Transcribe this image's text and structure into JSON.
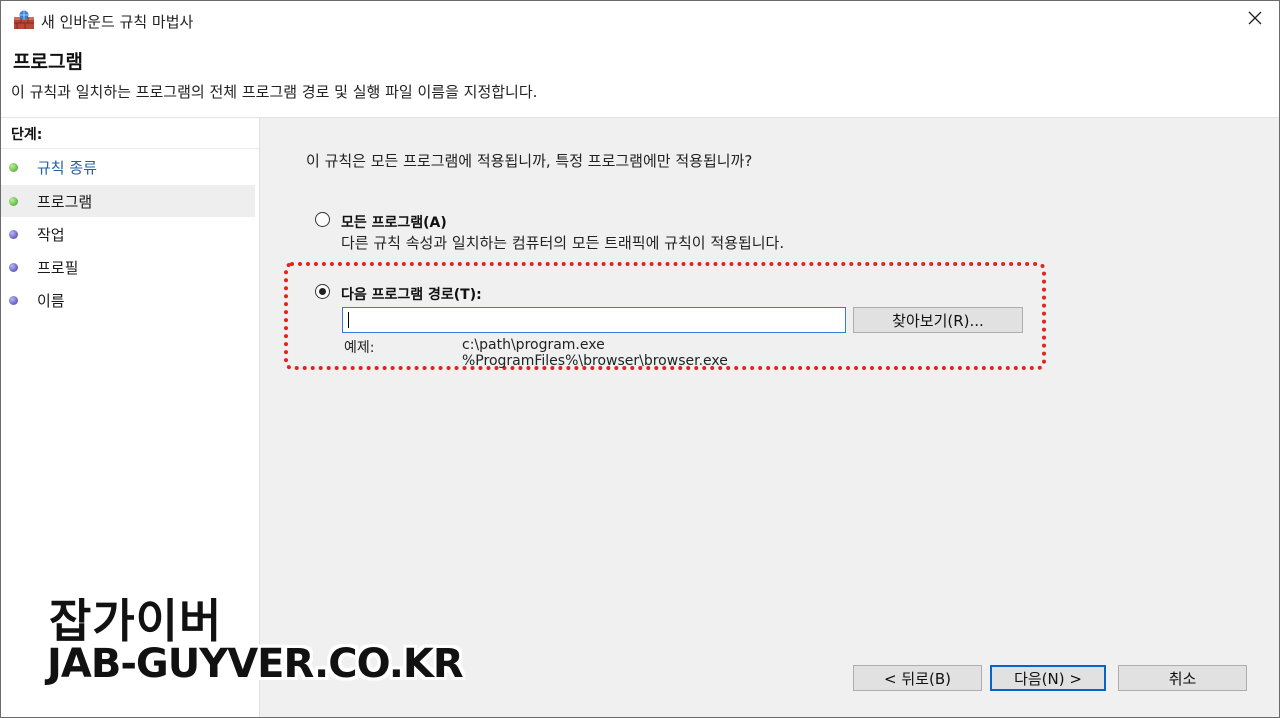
{
  "window": {
    "title": "새 인바운드 규칙 마법사",
    "icon": "firewall-wizard-icon",
    "close_glyph": "✕"
  },
  "header": {
    "title": "프로그램",
    "description": "이 규칙과 일치하는 프로그램의 전체 프로그램 경로 및 실행 파일 이름을 지정합니다."
  },
  "steps": {
    "heading": "단계:",
    "items": [
      {
        "label": "규칙 종류",
        "state": "completed",
        "color": "#3e9e1e"
      },
      {
        "label": "프로그램",
        "state": "current",
        "color": "#3e9e1e"
      },
      {
        "label": "작업",
        "state": "pending",
        "color": "#3c34a8"
      },
      {
        "label": "프로필",
        "state": "pending",
        "color": "#3c34a8"
      },
      {
        "label": "이름",
        "state": "pending",
        "color": "#3c34a8"
      }
    ]
  },
  "main": {
    "question": "이 규칙은 모든 프로그램에 적용됩니까, 특정 프로그램에만 적용됩니까?",
    "option_all": {
      "label": "모든 프로그램(A)",
      "description": "다른 규칙 속성과 일치하는 컴퓨터의 모든 트래픽에 규칙이 적용됩니다.",
      "selected": false
    },
    "option_path": {
      "label": "다음 프로그램 경로(T):",
      "selected": true,
      "input_value": "",
      "browse_label": "찾아보기(R)...",
      "example_label": "예제:",
      "example_lines": [
        "c:\\path\\program.exe",
        "%ProgramFiles%\\browser\\browser.exe"
      ]
    },
    "highlight_color": "#e0241e"
  },
  "footer": {
    "back_label": "< 뒤로(B)",
    "next_label": "다음(N) >",
    "cancel_label": "취소"
  },
  "watermark": {
    "korean": "잡가이버",
    "domain": "JAB-GUYVER.CO.KR"
  }
}
